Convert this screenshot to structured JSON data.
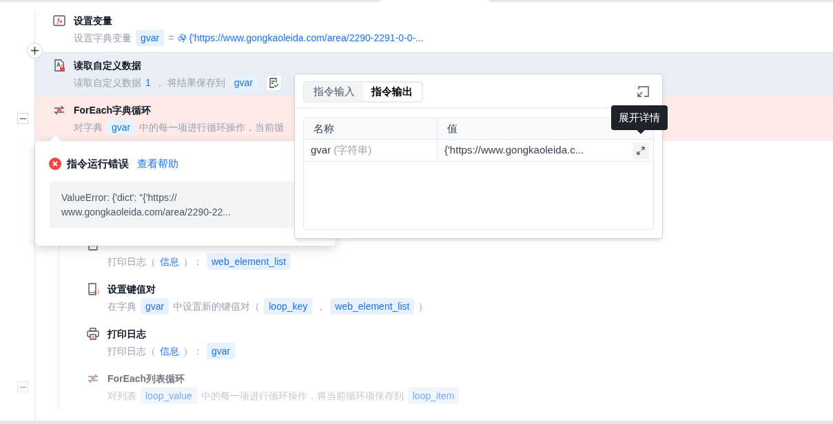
{
  "steps": [
    {
      "kind": "variable",
      "title": "设置变量",
      "selected": false,
      "error": false,
      "disabled": false,
      "description": [
        {
          "kind": "text",
          "text": "设置字典变量"
        },
        {
          "kind": "var",
          "text": "gvar"
        },
        {
          "kind": "text",
          "text": "="
        },
        {
          "kind": "python",
          "text": "{'https://www.gongkaoleida.com/area/2290-2291-0-0-..."
        }
      ]
    },
    {
      "kind": "read-data",
      "title": "读取自定义数据",
      "selected": true,
      "error": false,
      "disabled": false,
      "result_check": true,
      "description": [
        {
          "kind": "text",
          "text": "读取自定义数据"
        },
        {
          "kind": "value",
          "text": "1"
        },
        {
          "kind": "text",
          "text": "， 将结果保存到"
        },
        {
          "kind": "var",
          "text": "gvar"
        }
      ]
    },
    {
      "kind": "loop",
      "title": "ForEach字典循环",
      "selected": false,
      "error": true,
      "disabled": false,
      "expanded": true,
      "description": [
        {
          "kind": "text",
          "text": "对字典"
        },
        {
          "kind": "var",
          "text": "gvar"
        },
        {
          "kind": "text",
          "text": "中的每一项进行循环操作，当前循"
        }
      ],
      "children": [
        {
          "kind": "log",
          "selected": false,
          "error": false,
          "disabled": false,
          "description": [
            {
              "kind": "text",
              "text": "打印日志（"
            },
            {
              "kind": "value",
              "text": "信息"
            },
            {
              "kind": "text",
              "text": "）："
            },
            {
              "kind": "var",
              "text": "web_element_list"
            }
          ]
        },
        {
          "kind": "dict-set",
          "title": "设置键值对",
          "selected": false,
          "error": false,
          "disabled": false,
          "description": [
            {
              "kind": "text",
              "text": "在字典"
            },
            {
              "kind": "var",
              "text": "gvar"
            },
            {
              "kind": "text",
              "text": "中设置新的键值对（"
            },
            {
              "kind": "var",
              "text": "loop_key"
            },
            {
              "kind": "text",
              "text": "，"
            },
            {
              "kind": "var",
              "text": "web_element_list"
            },
            {
              "kind": "text",
              "text": "）"
            }
          ]
        },
        {
          "kind": "print",
          "title": "打印日志",
          "selected": false,
          "error": false,
          "disabled": false,
          "description": [
            {
              "kind": "text",
              "text": "打印日志（"
            },
            {
              "kind": "value",
              "text": "信息"
            },
            {
              "kind": "text",
              "text": "）："
            },
            {
              "kind": "var",
              "text": "gvar"
            }
          ]
        },
        {
          "kind": "loop",
          "title": "ForEach列表循环",
          "selected": false,
          "error": false,
          "disabled": true,
          "expanded": true,
          "description": [
            {
              "kind": "text",
              "text": "对列表"
            },
            {
              "kind": "var",
              "text": "loop_value"
            },
            {
              "kind": "text",
              "text": "中的每一项进行循环操作，将当前循环项保存到"
            },
            {
              "kind": "var",
              "text": "loop_item"
            }
          ]
        }
      ]
    }
  ],
  "error_popup": {
    "title": "指令运行错误",
    "help_link": "查看帮助",
    "message": "ValueError: {'dict': \"{'https://\nwww.gongkaoleida.com/area/2290-22..."
  },
  "output_panel": {
    "tabs": [
      {
        "label": "指令输入",
        "selected": false
      },
      {
        "label": "指令输出",
        "selected": true
      }
    ],
    "columns": [
      "名称",
      "值"
    ],
    "rows": [
      {
        "name": "gvar",
        "type": "(字符串)",
        "value": "{'https://www.gongkaoleida.c..."
      }
    ],
    "tooltip": "展开详情"
  }
}
